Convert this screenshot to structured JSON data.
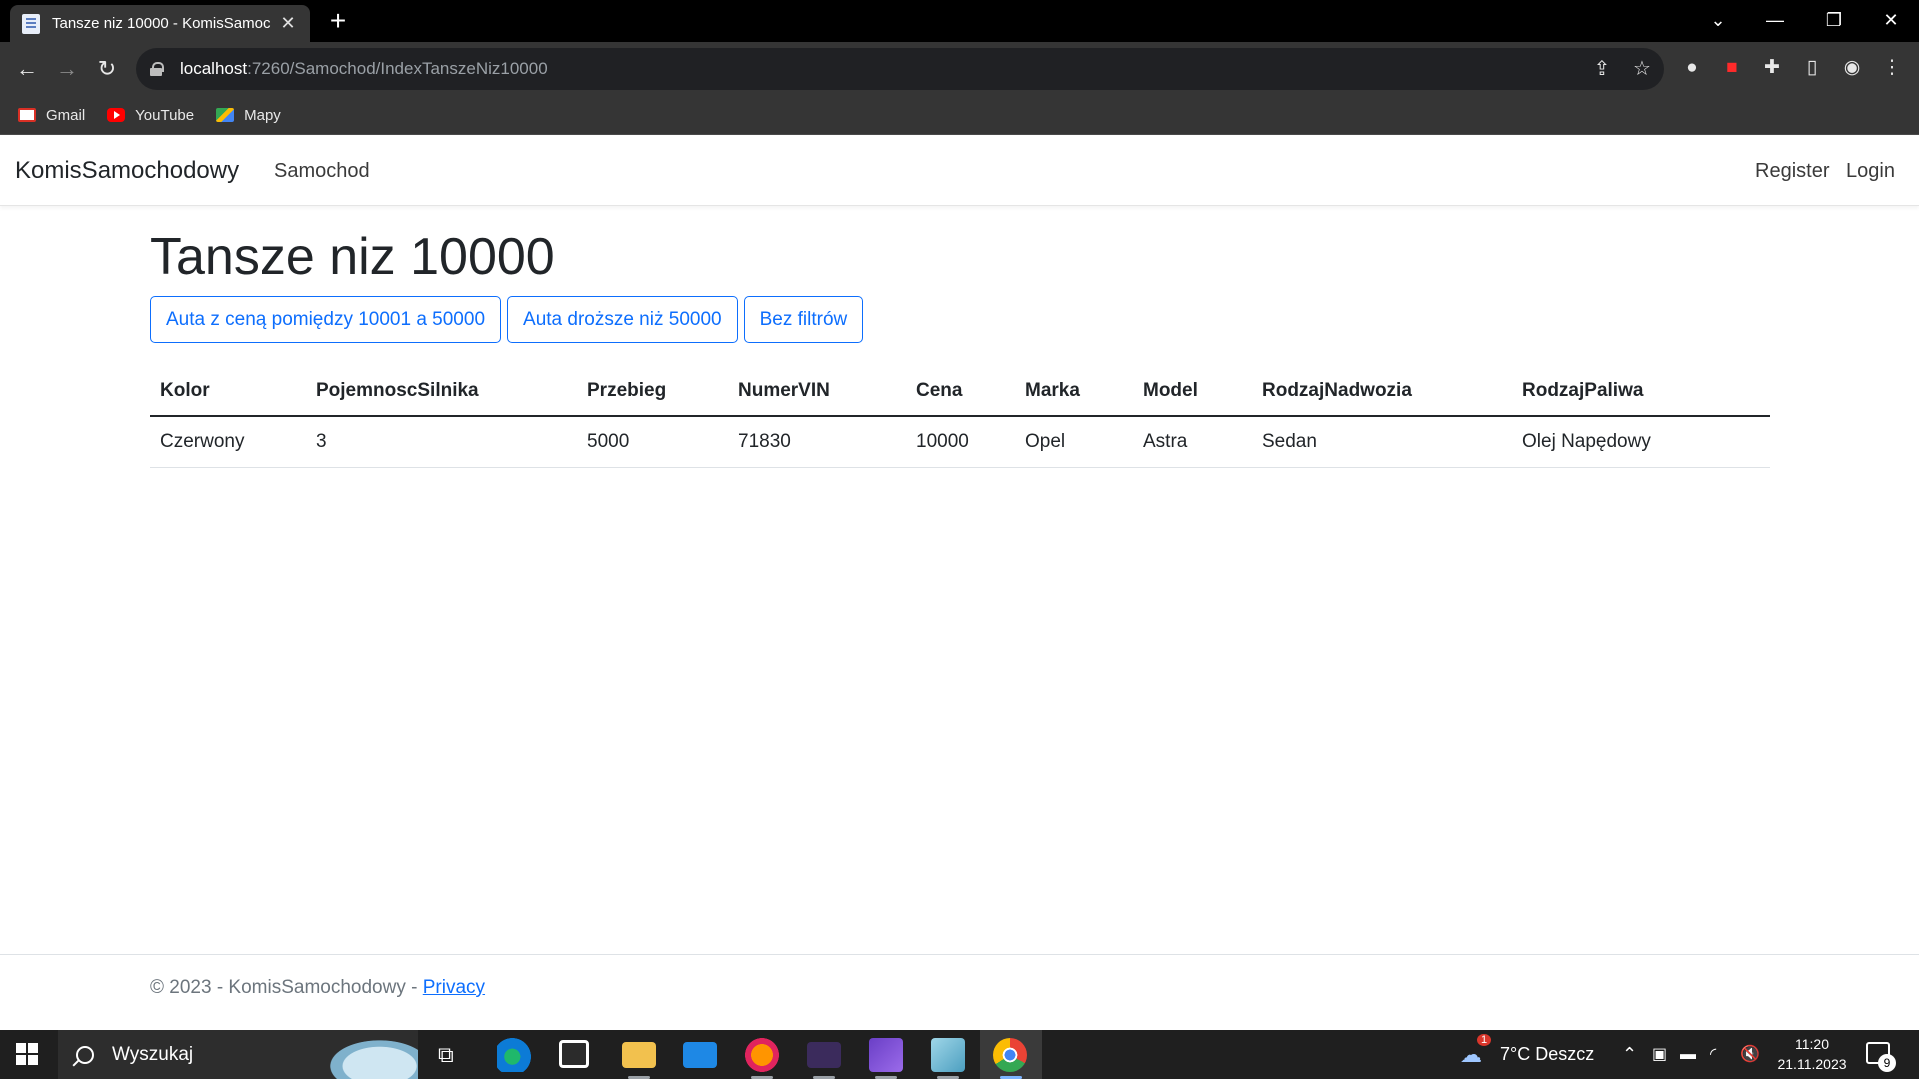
{
  "browser": {
    "tab_title": "Tansze niz 10000 - KomisSamoc",
    "tab_close": "✕",
    "new_tab": "+",
    "url_host": "localhost",
    "url_path": ":7260/Samochod/IndexTanszeNiz10000",
    "bookmarks": [
      {
        "label": "Gmail",
        "icon": "gmail-icon"
      },
      {
        "label": "YouTube",
        "icon": "youtube-icon"
      },
      {
        "label": "Mapy",
        "icon": "maps-icon"
      }
    ]
  },
  "site": {
    "brand": "KomisSamochodowy",
    "nav_samochod": "Samochod",
    "register": "Register",
    "login": "Login"
  },
  "main": {
    "title": "Tansze niz 10000",
    "filters": [
      "Auta z ceną pomiędzy 10001 a 50000",
      "Auta droższe niż 50000",
      "Bez filtrów"
    ],
    "table": {
      "headers": [
        "Kolor",
        "PojemnoscSilnika",
        "Przebieg",
        "NumerVIN",
        "Cena",
        "Marka",
        "Model",
        "RodzajNadwozia",
        "RodzajPaliwa"
      ],
      "rows": [
        [
          "Czerwony",
          "3",
          "5000",
          "71830",
          "10000",
          "Opel",
          "Astra",
          "Sedan",
          "Olej Napędowy"
        ]
      ]
    }
  },
  "footer": {
    "text": "© 2023 - KomisSamochodowy - ",
    "privacy": "Privacy"
  },
  "taskbar": {
    "search_placeholder": "Wyszukaj",
    "weather": "7°C  Deszcz",
    "weather_badge": "1",
    "time": "11:20",
    "date": "21.11.2023",
    "notifications": "9"
  },
  "colors": {
    "primary": "#0d6efd",
    "text": "#212529",
    "chrome_dark": "#353535"
  }
}
